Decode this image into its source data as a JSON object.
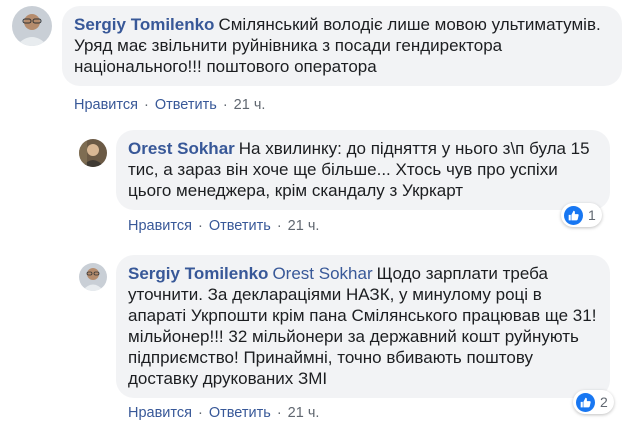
{
  "comments": [
    {
      "author": "Sergiy Tomilenko",
      "mention": "",
      "text": "Смілянський володіє лише мовою ультиматумів. Уряд має звільнити руйнівника з посади гендиректора національного!!! поштового оператора",
      "like_label": "Нравится",
      "reply_label": "Ответить",
      "time": "21 ч.",
      "reactions": ""
    },
    {
      "author": "Orest Sokhar",
      "mention": "",
      "text": "На хвилинку: до підняття у нього з\\п була 15 тис, а зараз він хоче ще більше... Хтось чув про успіхи цього менеджера, крім скандалу з Укркарт",
      "like_label": "Нравится",
      "reply_label": "Ответить",
      "time": "21 ч.",
      "reactions": "1"
    },
    {
      "author": "Sergiy Tomilenko",
      "mention": "Orest Sokhar",
      "text": "Щодо зарплати треба уточнити. За деклараціями НАЗК, у минулому році в апараті Укрпошти крім пана Смілянського працював ще 31! мільйонер!!! 32 мільйонери за державний кошт руйнують підприємство! Принаймні, точно вбивають поштову доставку друкованих ЗМІ",
      "like_label": "Нравится",
      "reply_label": "Ответить",
      "time": "21 ч.",
      "reactions": "2"
    }
  ],
  "separator": "·",
  "colors": {
    "link": "#385898",
    "bubble": "#f2f3f5",
    "like": "#1877f2",
    "meta": "#606770"
  }
}
